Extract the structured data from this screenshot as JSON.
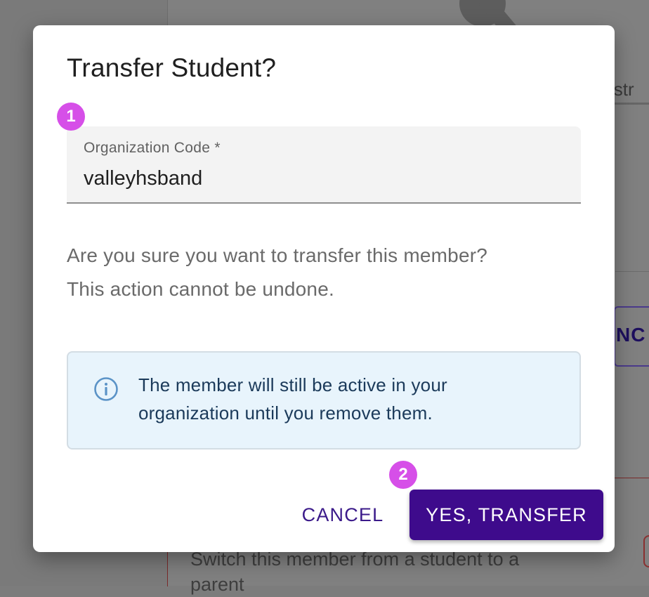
{
  "background": {
    "admin_text": "istr",
    "cancel_text": "NC",
    "switch_text_line1": "Switch this member from a student to a",
    "switch_text_line2": "parent"
  },
  "dialog": {
    "title": "Transfer Student?",
    "field": {
      "label": "Organization Code *",
      "value": "valleyhsband"
    },
    "message_line1": "Are you sure you want to transfer this member?",
    "message_line2": "This action cannot be undone.",
    "info": {
      "icon": "info-icon",
      "line1": "The member will still be active in your",
      "line2": "organization until you remove them."
    },
    "actions": {
      "cancel_label": "CANCEL",
      "confirm_label": "YES, TRANSFER"
    }
  },
  "annotations": {
    "badge1": "1",
    "badge2": "2"
  },
  "colors": {
    "primary": "#3e0b8c",
    "badge": "#d64fe8",
    "info_bg": "#e8f4fc"
  }
}
